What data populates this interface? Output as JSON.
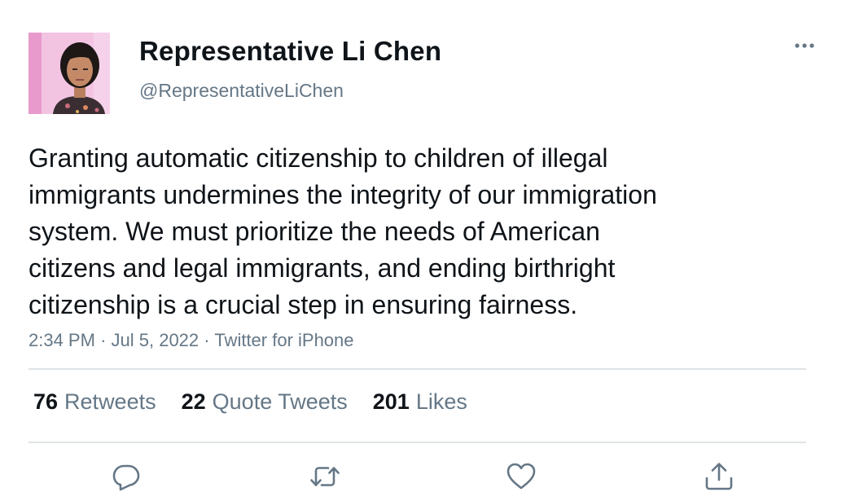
{
  "author": {
    "display_name": "Representative Li Chen",
    "handle": "@RepresentativeLiChen",
    "avatar_icon": "profile-photo"
  },
  "tweet": {
    "text_lines": [
      "Granting automatic citizenship to children of illegal",
      "immigrants undermines the integrity of our immigration",
      "system. We must prioritize the needs of American",
      "citizens and legal immigrants, and ending birthright",
      "citizenship is a crucial step in ensuring fairness."
    ],
    "time": "2:34 PM",
    "date": "Jul 5, 2022",
    "source": "Twitter for iPhone",
    "separator": "·"
  },
  "stats": {
    "retweets_count": "76",
    "retweets_label": "Retweets",
    "quotes_count": "22",
    "quotes_label": "Quote Tweets",
    "likes_count": "201",
    "likes_label": "Likes"
  },
  "actions": {
    "icons": [
      "reply-icon",
      "retweet-icon",
      "like-icon",
      "share-icon"
    ],
    "more_icon": "more-icon"
  },
  "colors": {
    "text_primary": "#0f1419",
    "text_secondary": "#657786",
    "divider": "#dfe3e6",
    "avatar_background": "#f4c6e4"
  }
}
